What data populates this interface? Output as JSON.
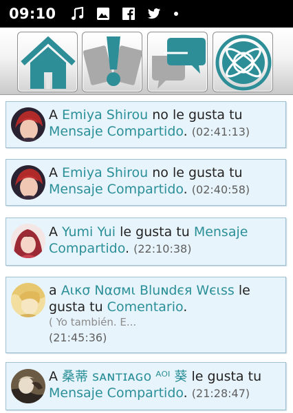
{
  "status_bar": {
    "time": "09:10",
    "icons": [
      "music-note-icon",
      "image-icon",
      "facebook-icon",
      "twitter-icon",
      "notification-dot-icon"
    ]
  },
  "toolbar": {
    "buttons": [
      {
        "name": "home",
        "icon": "home-icon"
      },
      {
        "name": "notifications",
        "icon": "exclamation-cards-icon"
      },
      {
        "name": "chat",
        "icon": "chat-bubbles-icon"
      },
      {
        "name": "explore",
        "icon": "planet-icon"
      }
    ],
    "accent": "#2e8e98"
  },
  "notifications": [
    {
      "prefix": "A ",
      "user": "Emiya Shirou",
      "verb": " no le gusta tu ",
      "target": "Mensaje Compartido",
      "period": ".",
      "time": "(02:41:13)"
    },
    {
      "prefix": "A ",
      "user": "Emiya Shirou",
      "verb": " no le gusta tu ",
      "target": "Mensaje Compartido",
      "period": ".",
      "time": "(02:40:58)"
    },
    {
      "prefix": "A ",
      "user": "Yumi Yui",
      "verb": " le gusta tu ",
      "target": "Mensaje Compartido",
      "period": ".",
      "time": "(22:10:38)"
    },
    {
      "prefix": "a ",
      "user": "Αικσ Nασмι Bluɴdєя Wєιss",
      "verb": " le gusta tu ",
      "target": "Comentario",
      "period": ".",
      "excerpt": "( Yo también. E...",
      "time": "(21:45:36)"
    },
    {
      "prefix": "A ",
      "user": "桑蒂 ꜱᴀɴᴛɪᴀɢᴏ ᴬᴼᴵ 葵",
      "verb": " le gusta tu ",
      "target": "Mensaje Compartido",
      "period": ".",
      "time": "(21:28:47)"
    }
  ],
  "colors": {
    "link": "#2a8f98",
    "card_bg": "#e8f4fb",
    "card_border": "#9fbfd3"
  }
}
